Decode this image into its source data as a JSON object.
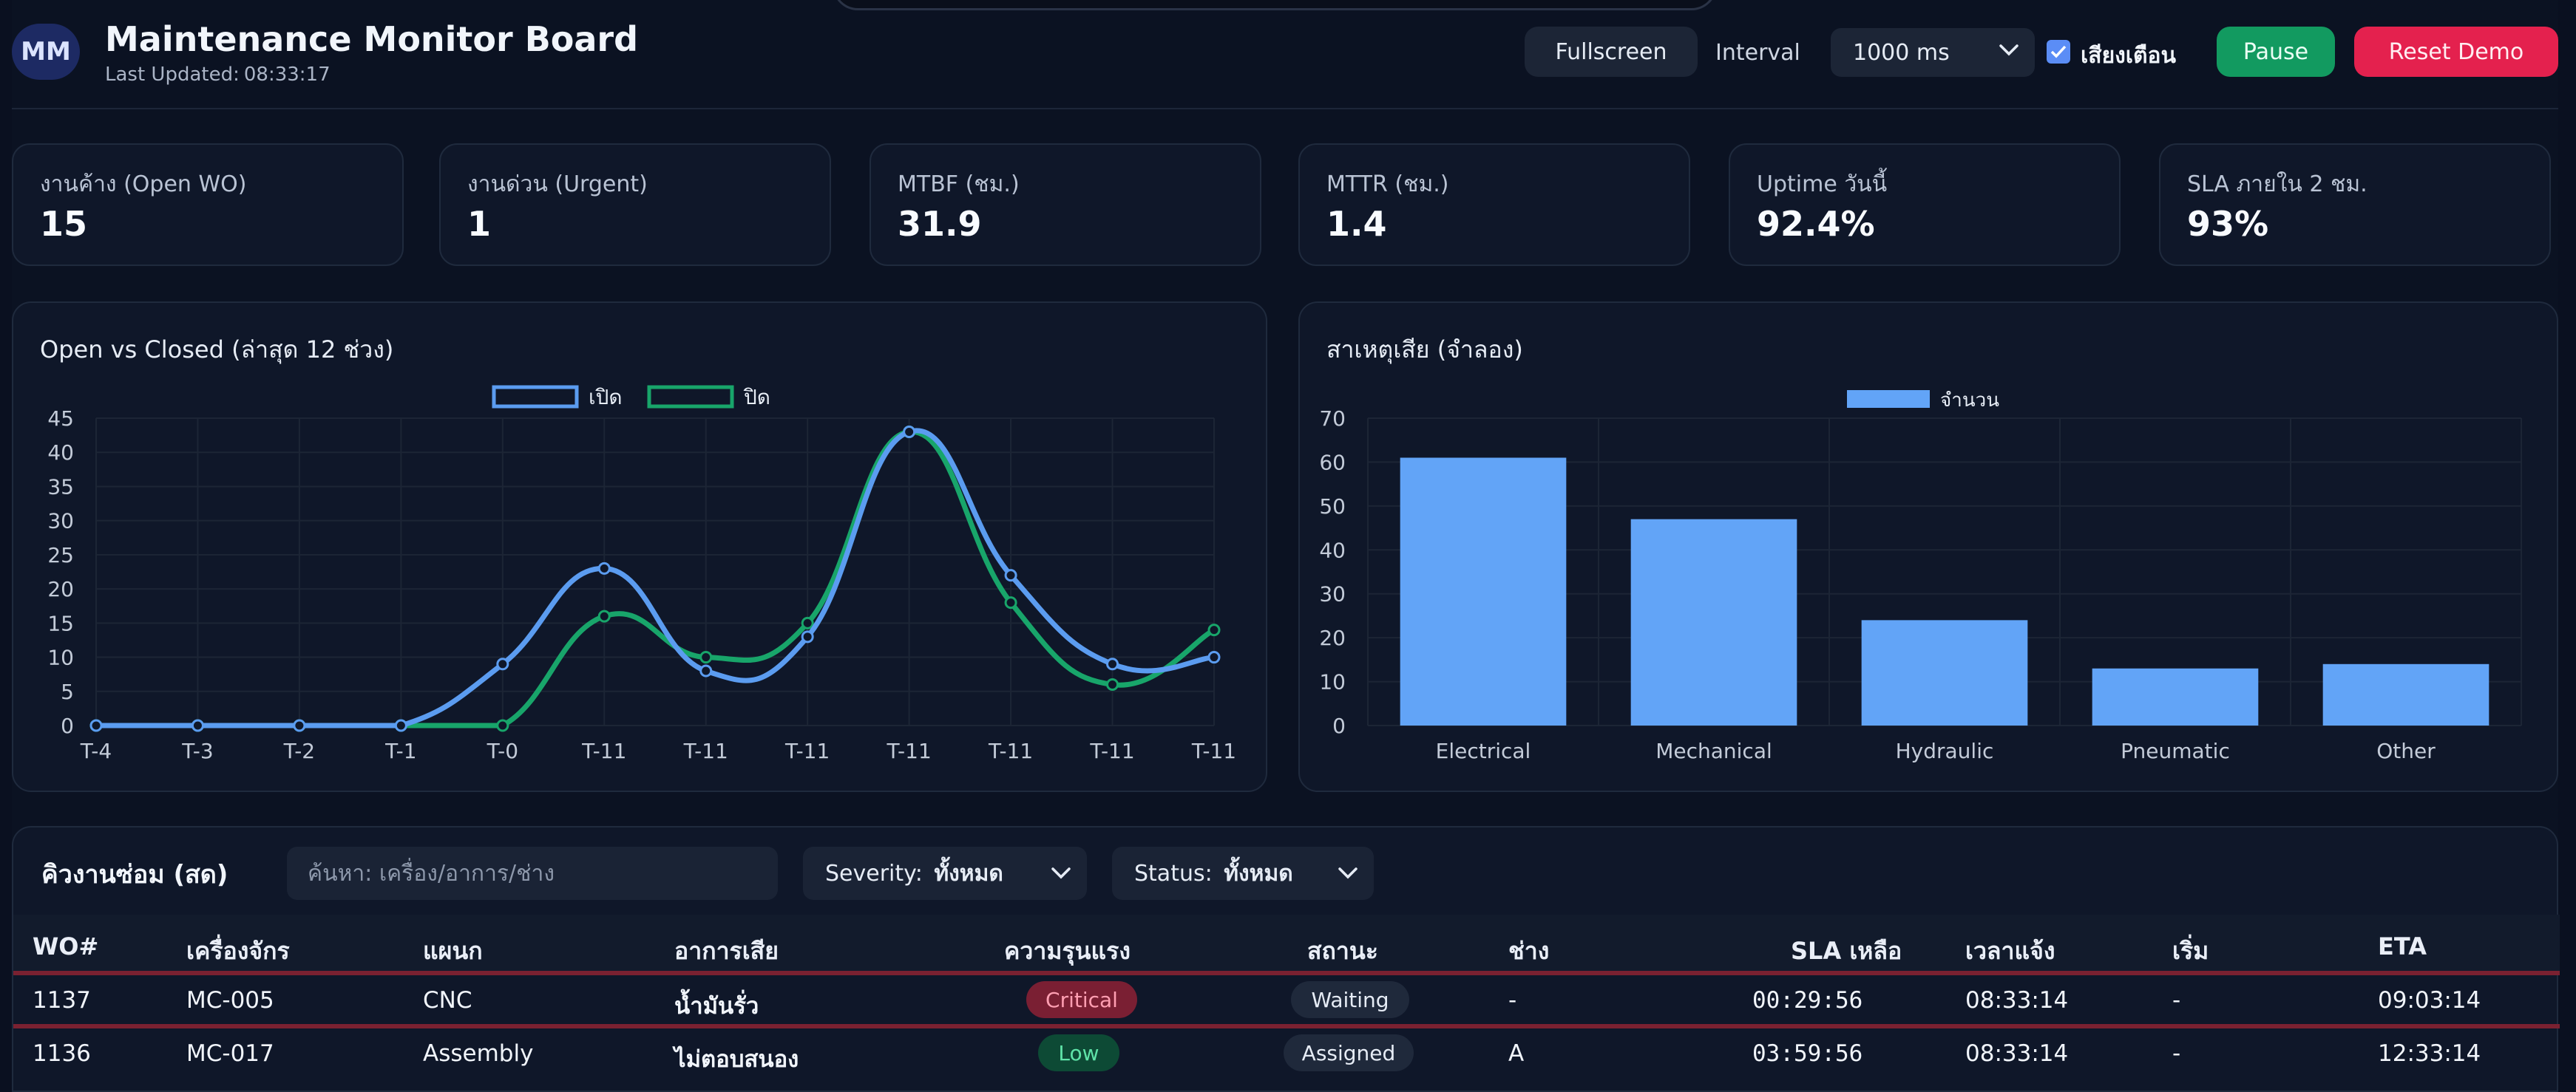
{
  "header": {
    "avatar": "MM",
    "title": "Maintenance Monitor Board",
    "updated_label": "Last Updated:",
    "updated_time": "08:33:17",
    "fullscreen": "Fullscreen",
    "interval_label": "Interval",
    "interval_value": "1000 ms",
    "sound_label": "เสียงเตือน",
    "sound_checked": true,
    "pause": "Pause",
    "reset": "Reset Demo"
  },
  "kpis": [
    {
      "label": "งานค้าง (Open WO)",
      "value": "15"
    },
    {
      "label": "งานด่วน (Urgent)",
      "value": "1"
    },
    {
      "label": "MTBF (ชม.)",
      "value": "31.9"
    },
    {
      "label": "MTTR (ชม.)",
      "value": "1.4"
    },
    {
      "label": "Uptime วันนี้",
      "value": "92.4%"
    },
    {
      "label": "SLA ภายใน 2 ชม.",
      "value": "93%"
    }
  ],
  "chart_data": [
    {
      "type": "line",
      "title": "Open vs Closed (ล่าสุด 12 ช่วง)",
      "x": [
        "T-4",
        "T-3",
        "T-2",
        "T-1",
        "T-0",
        "T-11",
        "T-11",
        "T-11",
        "T-11",
        "T-11",
        "T-11",
        "T-11"
      ],
      "series": [
        {
          "name": "เปิด",
          "color": "#5b9cf0",
          "values": [
            0,
            0,
            0,
            0,
            9,
            23,
            8,
            13,
            43,
            22,
            9,
            10
          ]
        },
        {
          "name": "ปิด",
          "color": "#18a56a",
          "values": [
            0,
            0,
            0,
            0,
            0,
            16,
            10,
            15,
            43,
            18,
            6,
            14
          ]
        }
      ],
      "ylim": [
        0,
        45
      ],
      "yticks": [
        0,
        5,
        10,
        15,
        20,
        25,
        30,
        35,
        40,
        45
      ],
      "legend": "top-center",
      "grid": true
    },
    {
      "type": "bar",
      "title": "สาเหตุเสีย (จำลอง)",
      "categories": [
        "Electrical",
        "Mechanical",
        "Hydraulic",
        "Pneumatic",
        "Other"
      ],
      "series": [
        {
          "name": "จำนวน",
          "color": "#62a4f7",
          "values": [
            61,
            47,
            24,
            13,
            14
          ]
        }
      ],
      "ylim": [
        0,
        70
      ],
      "yticks": [
        0,
        10,
        20,
        30,
        40,
        50,
        60,
        70
      ],
      "legend": "top-center",
      "grid": true
    }
  ],
  "queue": {
    "title": "คิวงานซ่อม (สด)",
    "search_placeholder": "ค้นหา: เครื่อง/อาการ/ช่าง",
    "severity_label": "Severity:",
    "severity_value": "ทั้งหมด",
    "status_label": "Status:",
    "status_value": "ทั้งหมด",
    "columns": [
      "WO#",
      "เครื่องจักร",
      "แผนก",
      "อาการเสีย",
      "ความรุนแรง",
      "สถานะ",
      "ช่าง",
      "SLA เหลือ",
      "เวลาแจ้ง",
      "เริ่ม",
      "ETA"
    ],
    "rows": [
      {
        "wo": "1137",
        "machine": "MC-005",
        "dept": "CNC",
        "symptom": "น้ำมันรั่ว",
        "severity": "Critical",
        "status": "Waiting",
        "tech": "-",
        "sla": "00:29:56",
        "reported": "08:33:14",
        "start": "-",
        "eta": "09:03:14"
      },
      {
        "wo": "1136",
        "machine": "MC-017",
        "dept": "Assembly",
        "symptom": "ไม่ตอบสนอง",
        "severity": "Low",
        "status": "Assigned",
        "tech": "A",
        "sla": "03:59:56",
        "reported": "08:33:14",
        "start": "-",
        "eta": "12:33:14"
      }
    ],
    "severity_colors": {
      "Critical": "#7a1f33",
      "Low": "#0d4a35"
    },
    "severity_text_colors": {
      "Critical": "#ff9fb2",
      "Low": "#5fe3a8"
    }
  }
}
